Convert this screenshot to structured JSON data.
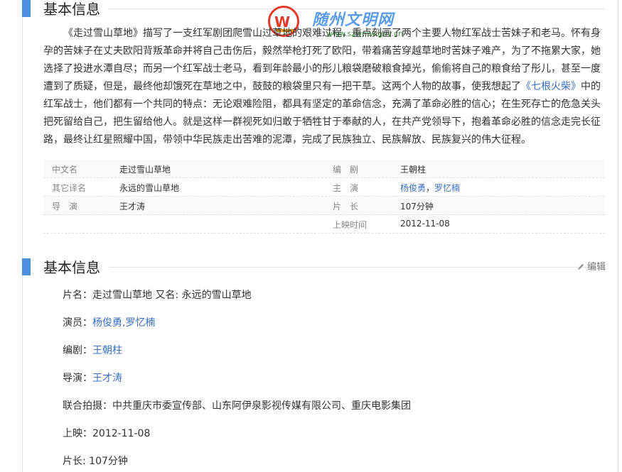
{
  "logo": {
    "emblem_text": "W",
    "site_name": "随州文明网",
    "url": "www.szwmw.gov.cn"
  },
  "section1": {
    "title": "基本信息"
  },
  "intro": {
    "p1": "《走过雪山草地》描写了一支红军剧团爬雪山过草地的艰难过程，重点刻画了两个主要人物红军战士苦妹子和老马。怀有身孕的苦妹子在丈夫欧阳背叛革命并将自己击伤后，毅然举枪打死了欧阳，带着痛苦穿越草地时苦妹子难产，为了不拖累大家，她选择了投进水潭自尽；而另一个红军战士老马，看到年龄最小的彤儿粮袋磨破粮食掉光，偷偷将自己的粮食给了彤儿，甚至一度遭到了质疑，但是，最终他却饿死在草地之中，鼓鼓的粮袋里只有一把干草。这两个人物的故事，使我想起了",
    "link": "《七根火柴》",
    "p2": "中的红军战士，他们都有一个共同的特点：无论艰难险阻，都具有坚定的革命信念，充满了革命必胜的信心；在生死存亡的危急关头把死留给自己，把生留给他人。就是这样一群视死如归敢于牺牲甘于奉献的人，在共产党领导下，抱着革命必胜的信念走完长征路，最终让红星照耀中国，带领中华民族走出苦难的泥潭，完成了民族独立、民族解放、民族复兴的伟大征程。"
  },
  "info_table": {
    "rows": [
      {
        "k1": "中文名",
        "v1": "走过雪山草地",
        "k2": "编　剧",
        "v2": "王朝柱"
      },
      {
        "k1": "其它译名",
        "v1": "永远的雪山草地",
        "k2": "主　演",
        "v2a": "杨俊勇",
        "sep": "，",
        "v2b": "罗忆楠"
      },
      {
        "k1": "导　演",
        "v1": "王才涛",
        "k2": "片　长",
        "v2": "107分钟"
      },
      {
        "k1": "",
        "v1": "",
        "k2": "上映时间",
        "v2": "2012-11-08"
      }
    ]
  },
  "section2": {
    "title": "基本信息",
    "edit_label": "编辑"
  },
  "details": {
    "title_line": "片名：走过雪山草地 又名: 永远的雪山草地",
    "cast_label": "演员：",
    "cast_value": "杨俊勇,罗忆楠",
    "writer_label": "编剧：",
    "writer_value": "王朝柱",
    "director_label": "导演：",
    "director_value": "王才涛",
    "coproduction": "联合拍摄：中共重庆市委宣传部、山东阿伊泉影视传媒有限公司、重庆电影集团",
    "release": "上映：2012-11-08",
    "runtime": "片长: 107分钟"
  },
  "colors": {
    "accent": "#4b8fe0",
    "link": "#3a6fc4",
    "logo_red": "#e23b2c"
  }
}
